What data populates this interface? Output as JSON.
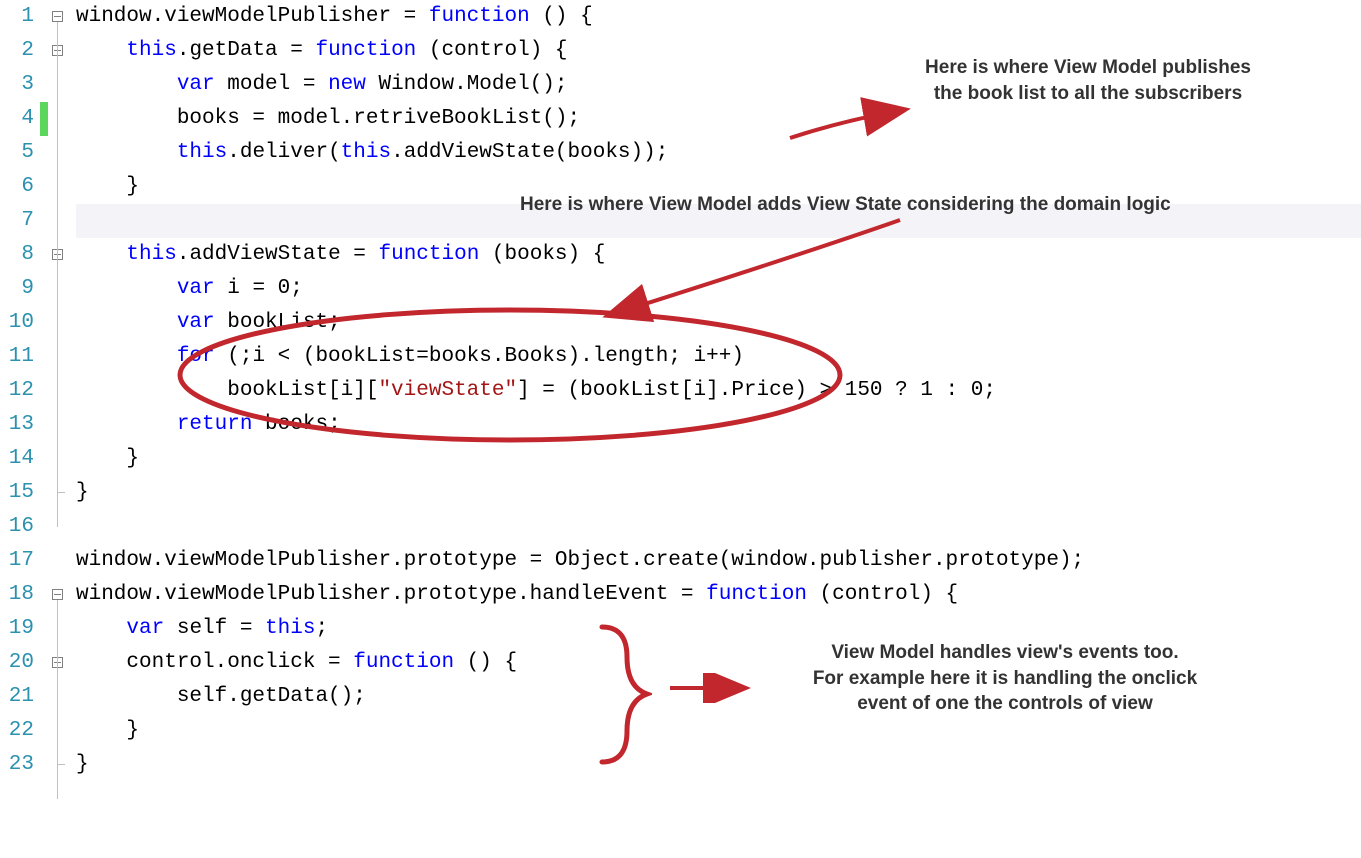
{
  "lines": [
    {
      "num": "1",
      "tokens": [
        "",
        "window.viewModelPublisher = ",
        [
          "kw",
          "function"
        ],
        " () {"
      ],
      "fold": "box"
    },
    {
      "num": "2",
      "tokens": [
        "    ",
        [
          "kw",
          "this"
        ],
        ".getData = ",
        [
          "kw",
          "function"
        ],
        " (control) {"
      ],
      "fold": "box"
    },
    {
      "num": "3",
      "tokens": [
        "        ",
        [
          "kw",
          "var"
        ],
        " model = ",
        [
          "kw",
          "new"
        ],
        " Window.Model();"
      ]
    },
    {
      "num": "4",
      "tokens": [
        "        books = model.retriveBookList();"
      ]
    },
    {
      "num": "5",
      "tokens": [
        "        ",
        [
          "kw",
          "this"
        ],
        ".deliver(",
        [
          "kw",
          "this"
        ],
        ".addViewState(books));"
      ]
    },
    {
      "num": "6",
      "tokens": [
        "    }"
      ]
    },
    {
      "num": "7",
      "tokens": [
        ""
      ],
      "highlight": true
    },
    {
      "num": "8",
      "tokens": [
        "    ",
        [
          "kw",
          "this"
        ],
        ".addViewState = ",
        [
          "kw",
          "function"
        ],
        " (books) {"
      ],
      "fold": "box"
    },
    {
      "num": "9",
      "tokens": [
        "        ",
        [
          "kw",
          "var"
        ],
        " i = 0;"
      ]
    },
    {
      "num": "10",
      "tokens": [
        "        ",
        [
          "kw",
          "var"
        ],
        " bookList;"
      ]
    },
    {
      "num": "11",
      "tokens": [
        "        ",
        [
          "kw",
          "for"
        ],
        " (;i < (bookList=books.Books).length; i++)"
      ]
    },
    {
      "num": "12",
      "tokens": [
        "            bookList[i][",
        [
          "str",
          "\"viewState\""
        ],
        "] = (bookList[i].Price) > 150 ? 1 : 0;"
      ]
    },
    {
      "num": "13",
      "tokens": [
        "        ",
        [
          "kw",
          "return"
        ],
        " books;"
      ]
    },
    {
      "num": "14",
      "tokens": [
        "    }"
      ]
    },
    {
      "num": "15",
      "tokens": [
        "}"
      ],
      "fold": "end"
    },
    {
      "num": "16",
      "tokens": [
        ""
      ]
    },
    {
      "num": "17",
      "tokens": [
        "window.viewModelPublisher.prototype = Object.create(window.publisher.prototype);"
      ]
    },
    {
      "num": "18",
      "tokens": [
        "",
        "window.viewModelPublisher.prototype.handleEvent = ",
        [
          "kw",
          "function"
        ],
        " (control) {"
      ],
      "fold": "box"
    },
    {
      "num": "19",
      "tokens": [
        "    ",
        [
          "kw",
          "var"
        ],
        " self = ",
        [
          "kw",
          "this"
        ],
        ";"
      ]
    },
    {
      "num": "20",
      "tokens": [
        "    control.onclick = ",
        [
          "kw",
          "function"
        ],
        " () {"
      ],
      "fold": "box"
    },
    {
      "num": "21",
      "tokens": [
        "        self.getData();"
      ]
    },
    {
      "num": "22",
      "tokens": [
        "    }"
      ]
    },
    {
      "num": "23",
      "tokens": [
        "}"
      ],
      "fold": "end"
    }
  ],
  "annotations": {
    "a1": "Here is where View Model publishes the book list to all the subscribers",
    "a2": "Here is where View Model adds View State considering the domain logic",
    "a3_l1": "View Model handles view's events too.",
    "a3_l2": "For example here it is handling the onclick",
    "a3_l3": "event of one the controls of view"
  }
}
